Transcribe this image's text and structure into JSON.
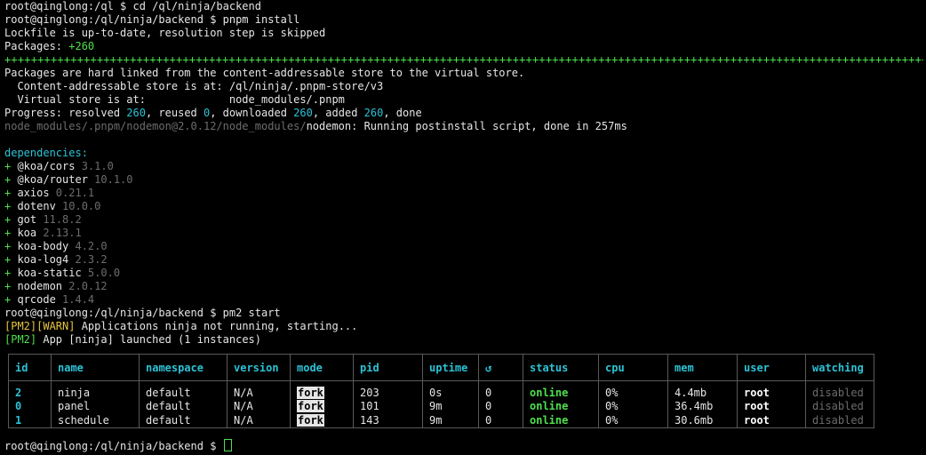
{
  "terminal": {
    "lines": {
      "l0": "root@qinglong:/ql $ cd /ql/ninja/backend",
      "l1": "root@qinglong:/ql/ninja/backend $ pnpm install",
      "l2": "Lockfile is up-to-date, resolution step is skipped",
      "l3_label": "Packages: ",
      "l3_value": "+260",
      "l4_bar": "++++++++++++++++++++++++++++++++++++++++++++++++++++++++++++++++++++++++++++++++++++++++++++++++++++++++++++++++++++++++++++++++++++++++++++++++++++++++++++++++++++++",
      "l5": "Packages are hard linked from the content-addressable store to the virtual store.",
      "l6": "  Content-addressable store is at: /ql/ninja/.pnpm-store/v3",
      "l7": "  Virtual store is at:             node_modules/.pnpm",
      "l8_a": "Progress: resolved ",
      "l8_b": "260",
      "l8_c": ", reused ",
      "l8_d": "0",
      "l8_e": ", downloaded ",
      "l8_f": "260",
      "l8_g": ", added ",
      "l8_h": "260",
      "l8_i": ", done",
      "l9_path": "node_modules/.pnpm/nodemon@2.0.12/node_modules/",
      "l9_msg": "nodemon: Running postinstall script, done in 257ms",
      "l10_header": "dependencies:",
      "pm2_cmd": "root@qinglong:/ql/ninja/backend $ pm2 start",
      "pm2_warn_tag": "[PM2][WARN]",
      "pm2_warn_msg": " Applications ninja not running, starting...",
      "pm2_tag": "[PM2]",
      "pm2_msg": " App [ninja] launched (1 instances)",
      "final_prompt": "root@qinglong:/ql/ninja/backend $ "
    },
    "dependencies": [
      {
        "plus": "+ ",
        "name": "@koa/cors",
        "version": " 3.1.0"
      },
      {
        "plus": "+ ",
        "name": "@koa/router",
        "version": " 10.1.0"
      },
      {
        "plus": "+ ",
        "name": "axios",
        "version": " 0.21.1"
      },
      {
        "plus": "+ ",
        "name": "dotenv",
        "version": " 10.0.0"
      },
      {
        "plus": "+ ",
        "name": "got",
        "version": " 11.8.2"
      },
      {
        "plus": "+ ",
        "name": "koa",
        "version": " 2.13.1"
      },
      {
        "plus": "+ ",
        "name": "koa-body",
        "version": " 4.2.0"
      },
      {
        "plus": "+ ",
        "name": "koa-log4",
        "version": " 2.3.2"
      },
      {
        "plus": "+ ",
        "name": "koa-static",
        "version": " 5.0.0"
      },
      {
        "plus": "+ ",
        "name": "nodemon",
        "version": " 2.0.12"
      },
      {
        "plus": "+ ",
        "name": "qrcode",
        "version": " 1.4.4"
      }
    ]
  },
  "pm2_table": {
    "headers": {
      "id": "id",
      "name": "name",
      "namespace": "namespace",
      "version": "version",
      "mode": "mode",
      "pid": "pid",
      "uptime": "uptime",
      "restarts": "↺",
      "status": "status",
      "cpu": "cpu",
      "mem": "mem",
      "user": "user",
      "watching": "watching"
    },
    "rows": [
      {
        "id": "2",
        "name": "ninja",
        "namespace": "default",
        "version": "N/A",
        "mode": "fork",
        "pid": "203",
        "uptime": "0s",
        "restarts": "0",
        "status": "online",
        "cpu": "0%",
        "mem": "4.4mb",
        "user": "root",
        "watching": "disabled"
      },
      {
        "id": "0",
        "name": "panel",
        "namespace": "default",
        "version": "N/A",
        "mode": "fork",
        "pid": "101",
        "uptime": "9m",
        "restarts": "0",
        "status": "online",
        "cpu": "0%",
        "mem": "36.4mb",
        "user": "root",
        "watching": "disabled"
      },
      {
        "id": "1",
        "name": "schedule",
        "namespace": "default",
        "version": "N/A",
        "mode": "fork",
        "pid": "143",
        "uptime": "9m",
        "restarts": "0",
        "status": "online",
        "cpu": "0%",
        "mem": "30.6mb",
        "user": "root",
        "watching": "disabled"
      }
    ]
  },
  "colors": {
    "background": "#000000",
    "text": "#e6e6e6",
    "green": "#4ee04e",
    "cyan": "#2cc2d6",
    "gray": "#6d6d6d",
    "yellow": "#e5c63e"
  }
}
